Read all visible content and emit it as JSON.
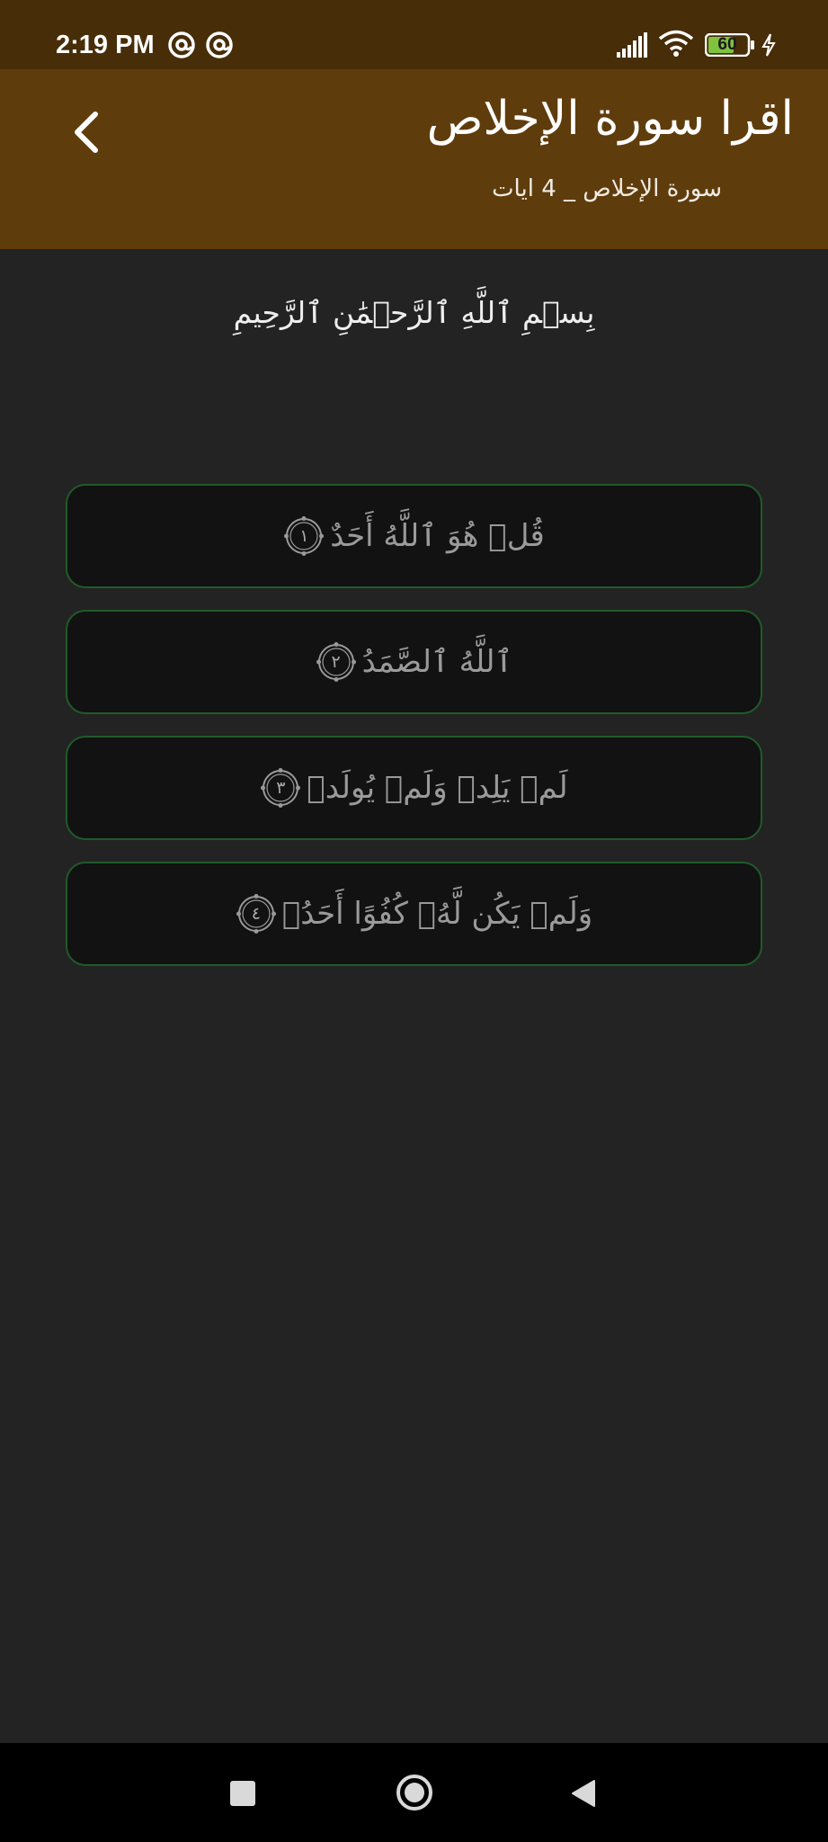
{
  "status_bar": {
    "time": "2:19 PM",
    "notification_icons": [
      "at-sign-icon",
      "at-sign-icon"
    ],
    "battery_level": "60",
    "icons": [
      "signal-icon",
      "wifi-icon",
      "battery-icon",
      "charging-icon"
    ]
  },
  "app_bar": {
    "title": "اقرا سورة الإخلاص",
    "subtitle": "سورة الإخلاص _ 4 ايات",
    "back_icon": "chevron-left-icon",
    "background": "#5f3c0c"
  },
  "content": {
    "basmala": "بِسۡمِ ٱللَّهِ ٱلرَّحۡمَٰنِ ٱلرَّحِيمِ",
    "ayat": [
      {
        "text": "قُلۡ هُوَ ٱللَّهُ أَحَدٌ",
        "number": "١"
      },
      {
        "text": "ٱللَّهُ ٱلصَّمَدُ",
        "number": "٢"
      },
      {
        "text": "لَمۡ يَلِدۡ وَلَمۡ يُولَدۡ",
        "number": "٣"
      },
      {
        "text": "وَلَمۡ يَكُن لَّهُۥ كُفُوًا أَحَدُۢ",
        "number": "٤"
      }
    ],
    "card_border_color": "#1f5b2a"
  },
  "nav_bar": {
    "icons": [
      "recents-square-icon",
      "home-circle-icon",
      "back-triangle-icon"
    ]
  }
}
